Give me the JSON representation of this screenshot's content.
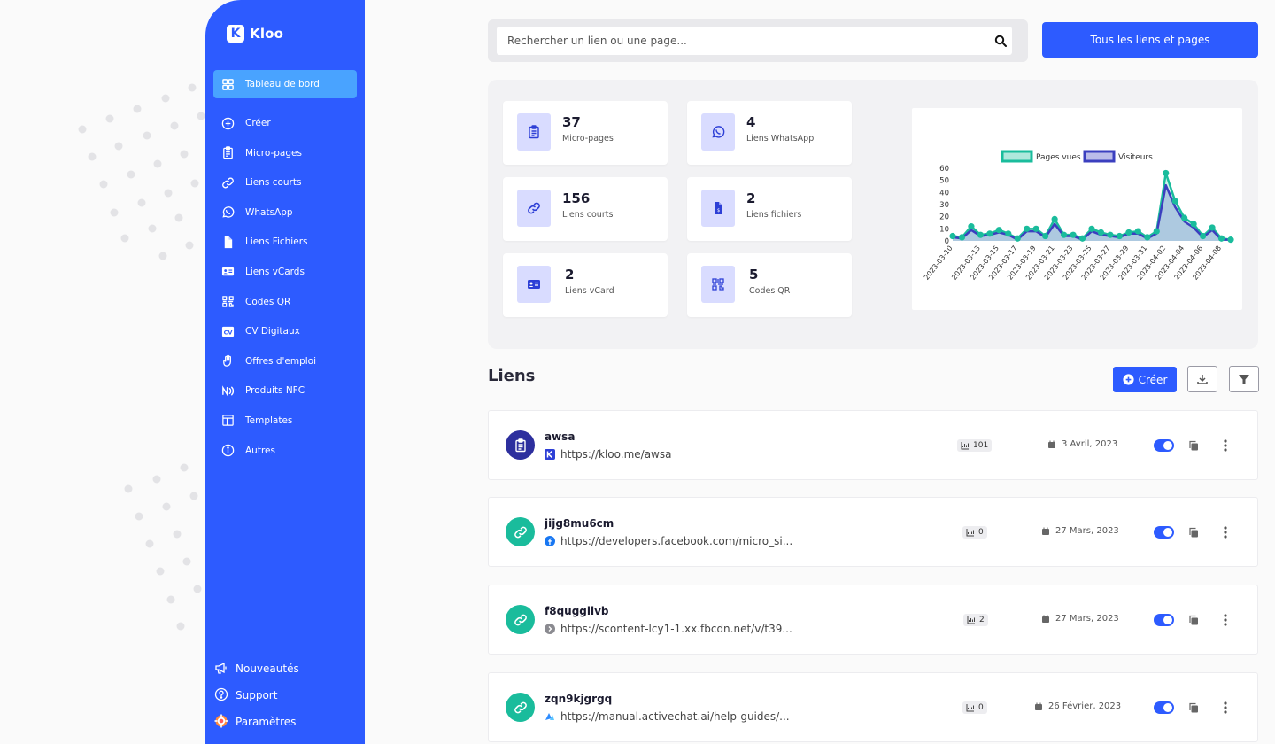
{
  "brand": {
    "name": "Kloo",
    "logo_letter": "K"
  },
  "sidebar": {
    "items": [
      {
        "label": "Tableau de bord",
        "icon": "dashboard-icon",
        "active": true
      },
      {
        "label": "Créer",
        "icon": "plus-circle-icon"
      },
      {
        "label": "Micro-pages",
        "icon": "clipboard-icon"
      },
      {
        "label": "Liens courts",
        "icon": "link-icon"
      },
      {
        "label": "WhatsApp",
        "icon": "whatsapp-icon"
      },
      {
        "label": "Liens Fichiers",
        "icon": "file-icon"
      },
      {
        "label": "Liens vCards",
        "icon": "id-card-icon"
      },
      {
        "label": "Codes QR",
        "icon": "qr-code-icon"
      },
      {
        "label": "CV Digitaux",
        "icon": "cv-icon"
      },
      {
        "label": "Offres d'emploi",
        "icon": "hand-icon"
      },
      {
        "label": "Produits NFC",
        "icon": "nfc-icon"
      },
      {
        "label": "Templates",
        "icon": "template-icon"
      },
      {
        "label": "Autres",
        "icon": "info-icon"
      }
    ],
    "bottom": [
      {
        "label": "Nouveautés",
        "icon": "megaphone-icon"
      },
      {
        "label": "Support",
        "icon": "help-icon"
      },
      {
        "label": "Paramètres",
        "icon": "settings-icon"
      }
    ]
  },
  "search": {
    "placeholder": "Rechercher un lien ou une page..."
  },
  "top_button": {
    "label": "Tous les liens et pages"
  },
  "stats": [
    {
      "value": "37",
      "label": "Micro-pages",
      "icon": "clipboard-icon"
    },
    {
      "value": "4",
      "label": "Liens WhatsApp",
      "icon": "whatsapp-icon"
    },
    {
      "value": "156",
      "label": "Liens courts",
      "icon": "link-icon"
    },
    {
      "value": "2",
      "label": "Liens fichiers",
      "icon": "file-icon"
    },
    {
      "value": "2",
      "label": "Liens vCard",
      "icon": "id-card-icon"
    },
    {
      "value": "5",
      "label": "Codes QR",
      "icon": "qr-code-icon"
    }
  ],
  "chart_data": {
    "type": "area",
    "x": [
      "2023-03-10",
      "2023-03-11",
      "2023-03-12",
      "2023-03-13",
      "2023-03-14",
      "2023-03-15",
      "2023-03-16",
      "2023-03-17",
      "2023-03-18",
      "2023-03-19",
      "2023-03-20",
      "2023-03-21",
      "2023-03-22",
      "2023-03-23",
      "2023-03-24",
      "2023-03-25",
      "2023-03-26",
      "2023-03-27",
      "2023-03-28",
      "2023-03-29",
      "2023-03-30",
      "2023-03-31",
      "2023-04-01",
      "2023-04-02",
      "2023-04-03",
      "2023-04-04",
      "2023-04-05",
      "2023-04-06",
      "2023-04-07",
      "2023-04-08",
      "2023-04-09"
    ],
    "x_tick_labels": [
      "2023-03-10",
      "2023-03-13",
      "2023-03-15",
      "2023-03-17",
      "2023-03-19",
      "2023-03-21",
      "2023-03-23",
      "2023-03-25",
      "2023-03-27",
      "2023-03-29",
      "2023-03-31",
      "2023-04-02",
      "2023-04-04",
      "2023-04-06",
      "2023-04-08"
    ],
    "series": [
      {
        "name": "Pages vues",
        "color": "#1abc9c",
        "values": [
          4,
          3,
          12,
          5,
          6,
          9,
          6,
          2,
          10,
          10,
          4,
          18,
          5,
          5,
          2,
          10,
          7,
          5,
          4,
          7,
          8,
          3,
          8,
          56,
          33,
          19,
          14,
          4,
          11,
          2,
          1
        ]
      },
      {
        "name": "Visiteurs",
        "color": "#3b3fbf",
        "values": [
          3,
          2,
          9,
          4,
          5,
          7,
          5,
          1,
          8,
          8,
          3,
          14,
          4,
          4,
          1,
          8,
          5,
          4,
          3,
          6,
          6,
          2,
          6,
          46,
          28,
          16,
          11,
          3,
          9,
          1,
          1
        ]
      }
    ],
    "ylim": [
      0,
      60
    ],
    "yticks": [
      0,
      10,
      20,
      30,
      40,
      50,
      60
    ],
    "legend": "top",
    "grid": false
  },
  "links_section": {
    "title": "Liens",
    "create_label": "Créer"
  },
  "links": [
    {
      "title": "awsa",
      "url": "https://kloo.me/awsa",
      "views": "101",
      "date": "3 Avril, 2023",
      "type": "micro-page",
      "favicon": "kloo-favicon-icon"
    },
    {
      "title": "jijg8mu6cm",
      "url": "https://developers.facebook.com/micro_si...",
      "views": "0",
      "date": "27 Mars, 2023",
      "type": "short-link",
      "favicon": "facebook-favicon-icon"
    },
    {
      "title": "f8quggllvb",
      "url": "https://scontent-lcy1-1.xx.fbcdn.net/v/t39...",
      "views": "2",
      "date": "27 Mars, 2023",
      "type": "short-link",
      "favicon": "globe-favicon-icon"
    },
    {
      "title": "zqn9kjgrgq",
      "url": "https://manual.activechat.ai/help-guides/...",
      "views": "0",
      "date": "26 Février, 2023",
      "type": "short-link",
      "favicon": "activechat-favicon-icon"
    }
  ]
}
